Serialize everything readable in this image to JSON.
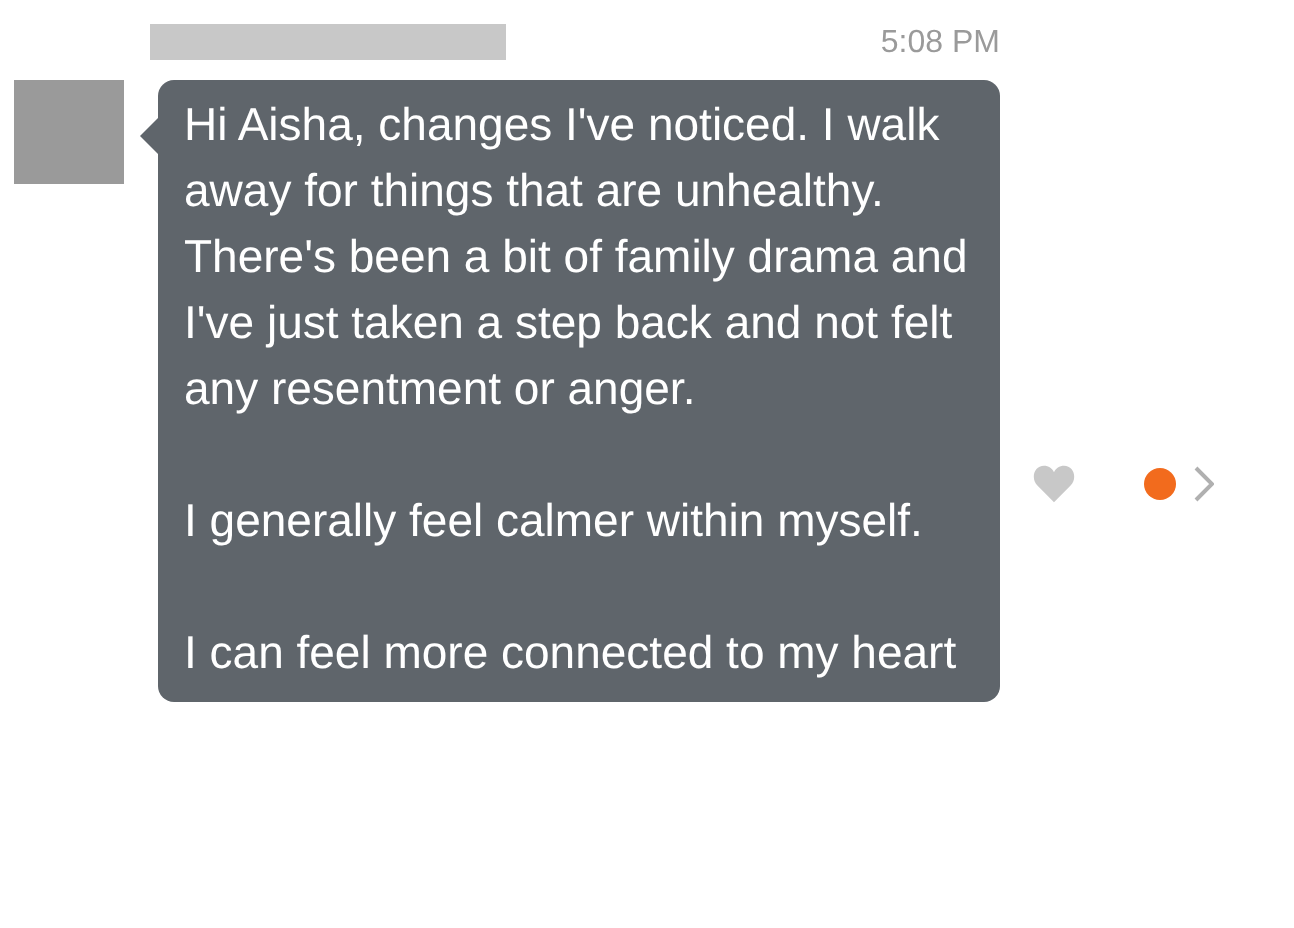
{
  "message": {
    "time": "5:08 PM",
    "paragraphs": [
      "Hi Aisha, changes I've noticed. I walk away for things that are unhealthy. There's been a bit of family drama and I've just taken a step back and not felt any resentment or anger.",
      "I generally feel calmer within myself.",
      "I can feel more connected to my heart"
    ],
    "liked": false,
    "unread": true
  }
}
